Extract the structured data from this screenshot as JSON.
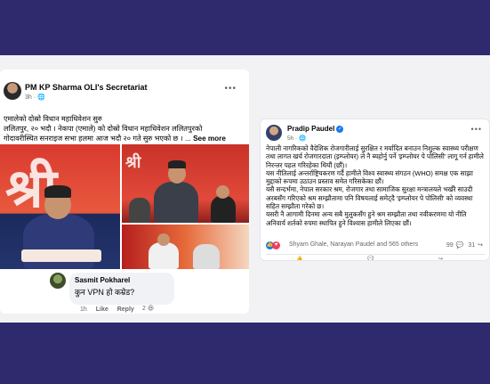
{
  "left_post": {
    "author": "PM KP Sharma OLI's Secretariat",
    "time": "3h",
    "text_lines": [
      "एमालेको दोस्रो विधान महाधिवेशन सुरु",
      "ललितपुर, २० भदौ । नेकपा (एमाले) को दोस्रो विधान महाधिवेशन  ललितपुरको",
      "गोदावरीस्थित सनराइज सभा हलमा आज भदौ २० गते सुरु भएको  छ । ..."
    ],
    "see_more": "See more",
    "comment": {
      "author": "Sasmit Pokharel",
      "text": "कुन VPN हो कम्रेड?",
      "time": "1h",
      "like": "Like",
      "reply": "Reply",
      "reaction_count": "2"
    }
  },
  "right_post": {
    "author": "Pradip Paudel",
    "time": "5h",
    "paragraphs": [
      "नेपाली नागरिकको वैदेशिक रोजगारीलाई सुरक्षित  र मर्यादित बनाउन निशुल्क स्वास्थ्य परीक्षण तथा लागत खर्च रोजगारदाता (इम्प्लोयर) ले नै ब्यहोर्नु पर्ने 'इम्प्लोयर पे पोलिसी' लागू गर्न हामीले निरन्तर पहल गरिरहेका थियौं (छौं)।",
      "यस नीतिलाई अन्तर्राष्ट्रियकरण गर्दै हामीले विश्व स्वास्थ्य संगठन (WHO) समक्ष एक साझा मुद्दाको रूपमा उठाउन प्रस्ताव समेत गरिसकेका छौं।",
      "यसै सन्दर्भमा, नेपाल सरकार श्रम, रोजगार तथा सामाजिक सुरक्षा मन्त्रालयले भर्खरै साउदी अरबसँग गरिएको श्रम सम्झौतामा पनि विषयलाई समेट्दै 'इम्प्लोयर पे पोलिसी' को व्यवस्था सहित सम्झौता गरेको छ।",
      "यसरी नै आगामी दिनमा अन्य सबै मुलुकसँग हुने श्रम सम्झौता तथा नवीकरणमा यो नीति अनिवार्य शर्तको रुपमा स्थापित हुने विश्वास हामीले लिएका छौं।"
    ],
    "reaction_names": "Shyam Ghale, Narayan Paudel and 565 others",
    "comment_count": "99",
    "share_count": "31"
  },
  "icons": {
    "like": "like-icon",
    "love": "love-icon",
    "comment": "comment-icon",
    "share": "share-icon",
    "verified": "verified-badge-icon",
    "more": "more-options-icon"
  },
  "colors": {
    "background": "#2f2a6d",
    "facebook_blue": "#1877f2",
    "love_red": "#f33e58"
  }
}
